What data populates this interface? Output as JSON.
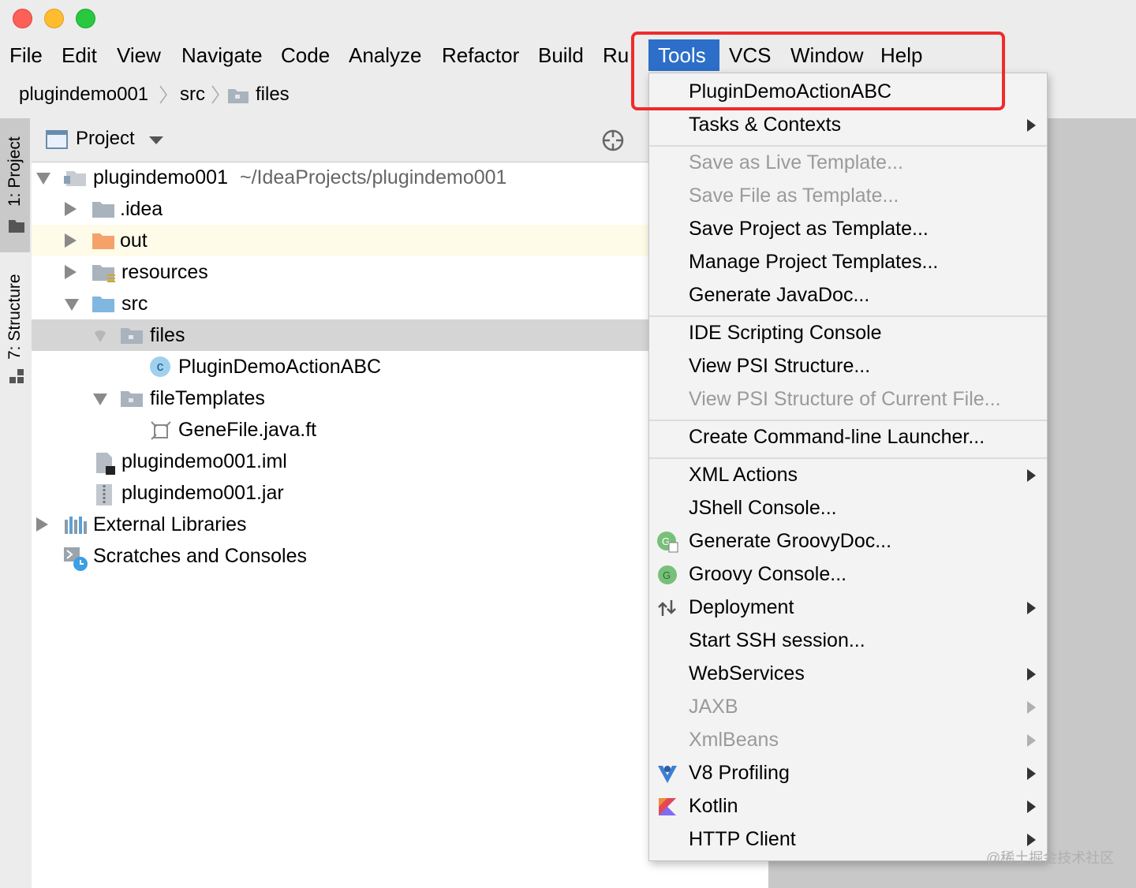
{
  "menubar": {
    "items": [
      "File",
      "Edit",
      "View",
      "Navigate",
      "Code",
      "Analyze",
      "Refactor",
      "Build",
      "Ru",
      "Tools",
      "VCS",
      "Window",
      "Help"
    ],
    "active": "Tools"
  },
  "breadcrumb": {
    "items": [
      "plugindemo001",
      "src",
      "files"
    ]
  },
  "toolstrip": {
    "project_tab": "1: Project",
    "structure_tab": "7: Structure"
  },
  "panel": {
    "title": "Project"
  },
  "tree": {
    "root_name": "plugindemo001",
    "root_path": "~/IdeaProjects/plugindemo001",
    "idea": ".idea",
    "out": "out",
    "resources": "resources",
    "src": "src",
    "files": "files",
    "class_file": "PluginDemoActionABC",
    "class_badge": "c",
    "file_templates": "fileTemplates",
    "template_file": "GeneFile.java.ft",
    "iml": "plugindemo001.iml",
    "jar": "plugindemo001.jar",
    "ext_libs": "External Libraries",
    "scratches": "Scratches and Consoles"
  },
  "tools_menu": {
    "items": [
      {
        "label": "PluginDemoActionABC",
        "disabled": false,
        "submenu": false
      },
      {
        "label": "Tasks & Contexts",
        "disabled": false,
        "submenu": true
      },
      {
        "label": "Save as Live Template...",
        "disabled": true,
        "submenu": false
      },
      {
        "label": "Save File as Template...",
        "disabled": true,
        "submenu": false
      },
      {
        "label": "Save Project as Template...",
        "disabled": false,
        "submenu": false
      },
      {
        "label": "Manage Project Templates...",
        "disabled": false,
        "submenu": false
      },
      {
        "label": "Generate JavaDoc...",
        "disabled": false,
        "submenu": false
      },
      {
        "label": "IDE Scripting Console",
        "disabled": false,
        "submenu": false
      },
      {
        "label": "View PSI Structure...",
        "disabled": false,
        "submenu": false
      },
      {
        "label": "View PSI Structure of Current File...",
        "disabled": true,
        "submenu": false
      },
      {
        "label": "Create Command-line Launcher...",
        "disabled": false,
        "submenu": false
      },
      {
        "label": "XML Actions",
        "disabled": false,
        "submenu": true
      },
      {
        "label": "JShell Console...",
        "disabled": false,
        "submenu": false
      },
      {
        "label": "Generate GroovyDoc...",
        "disabled": false,
        "submenu": false,
        "icon": "groovydoc-icon"
      },
      {
        "label": "Groovy Console...",
        "disabled": false,
        "submenu": false,
        "icon": "groovy-icon"
      },
      {
        "label": "Deployment",
        "disabled": false,
        "submenu": true,
        "icon": "deployment-icon"
      },
      {
        "label": "Start SSH session...",
        "disabled": false,
        "submenu": false
      },
      {
        "label": "WebServices",
        "disabled": false,
        "submenu": true
      },
      {
        "label": "JAXB",
        "disabled": true,
        "submenu": true
      },
      {
        "label": "XmlBeans",
        "disabled": true,
        "submenu": true
      },
      {
        "label": "V8 Profiling",
        "disabled": false,
        "submenu": true,
        "icon": "v8-profiling-icon"
      },
      {
        "label": "Kotlin",
        "disabled": false,
        "submenu": true,
        "icon": "kotlin-icon"
      },
      {
        "label": "HTTP Client",
        "disabled": false,
        "submenu": true
      }
    ]
  },
  "watermark": "@稀土掘金技术社区",
  "colors": {
    "accent": "#2c6ec8",
    "highlight_box": "#ef2b2b",
    "folder_blue": "#7fb7e0",
    "folder_orange": "#f4a26a",
    "folder_gray": "#a9b3bd"
  }
}
